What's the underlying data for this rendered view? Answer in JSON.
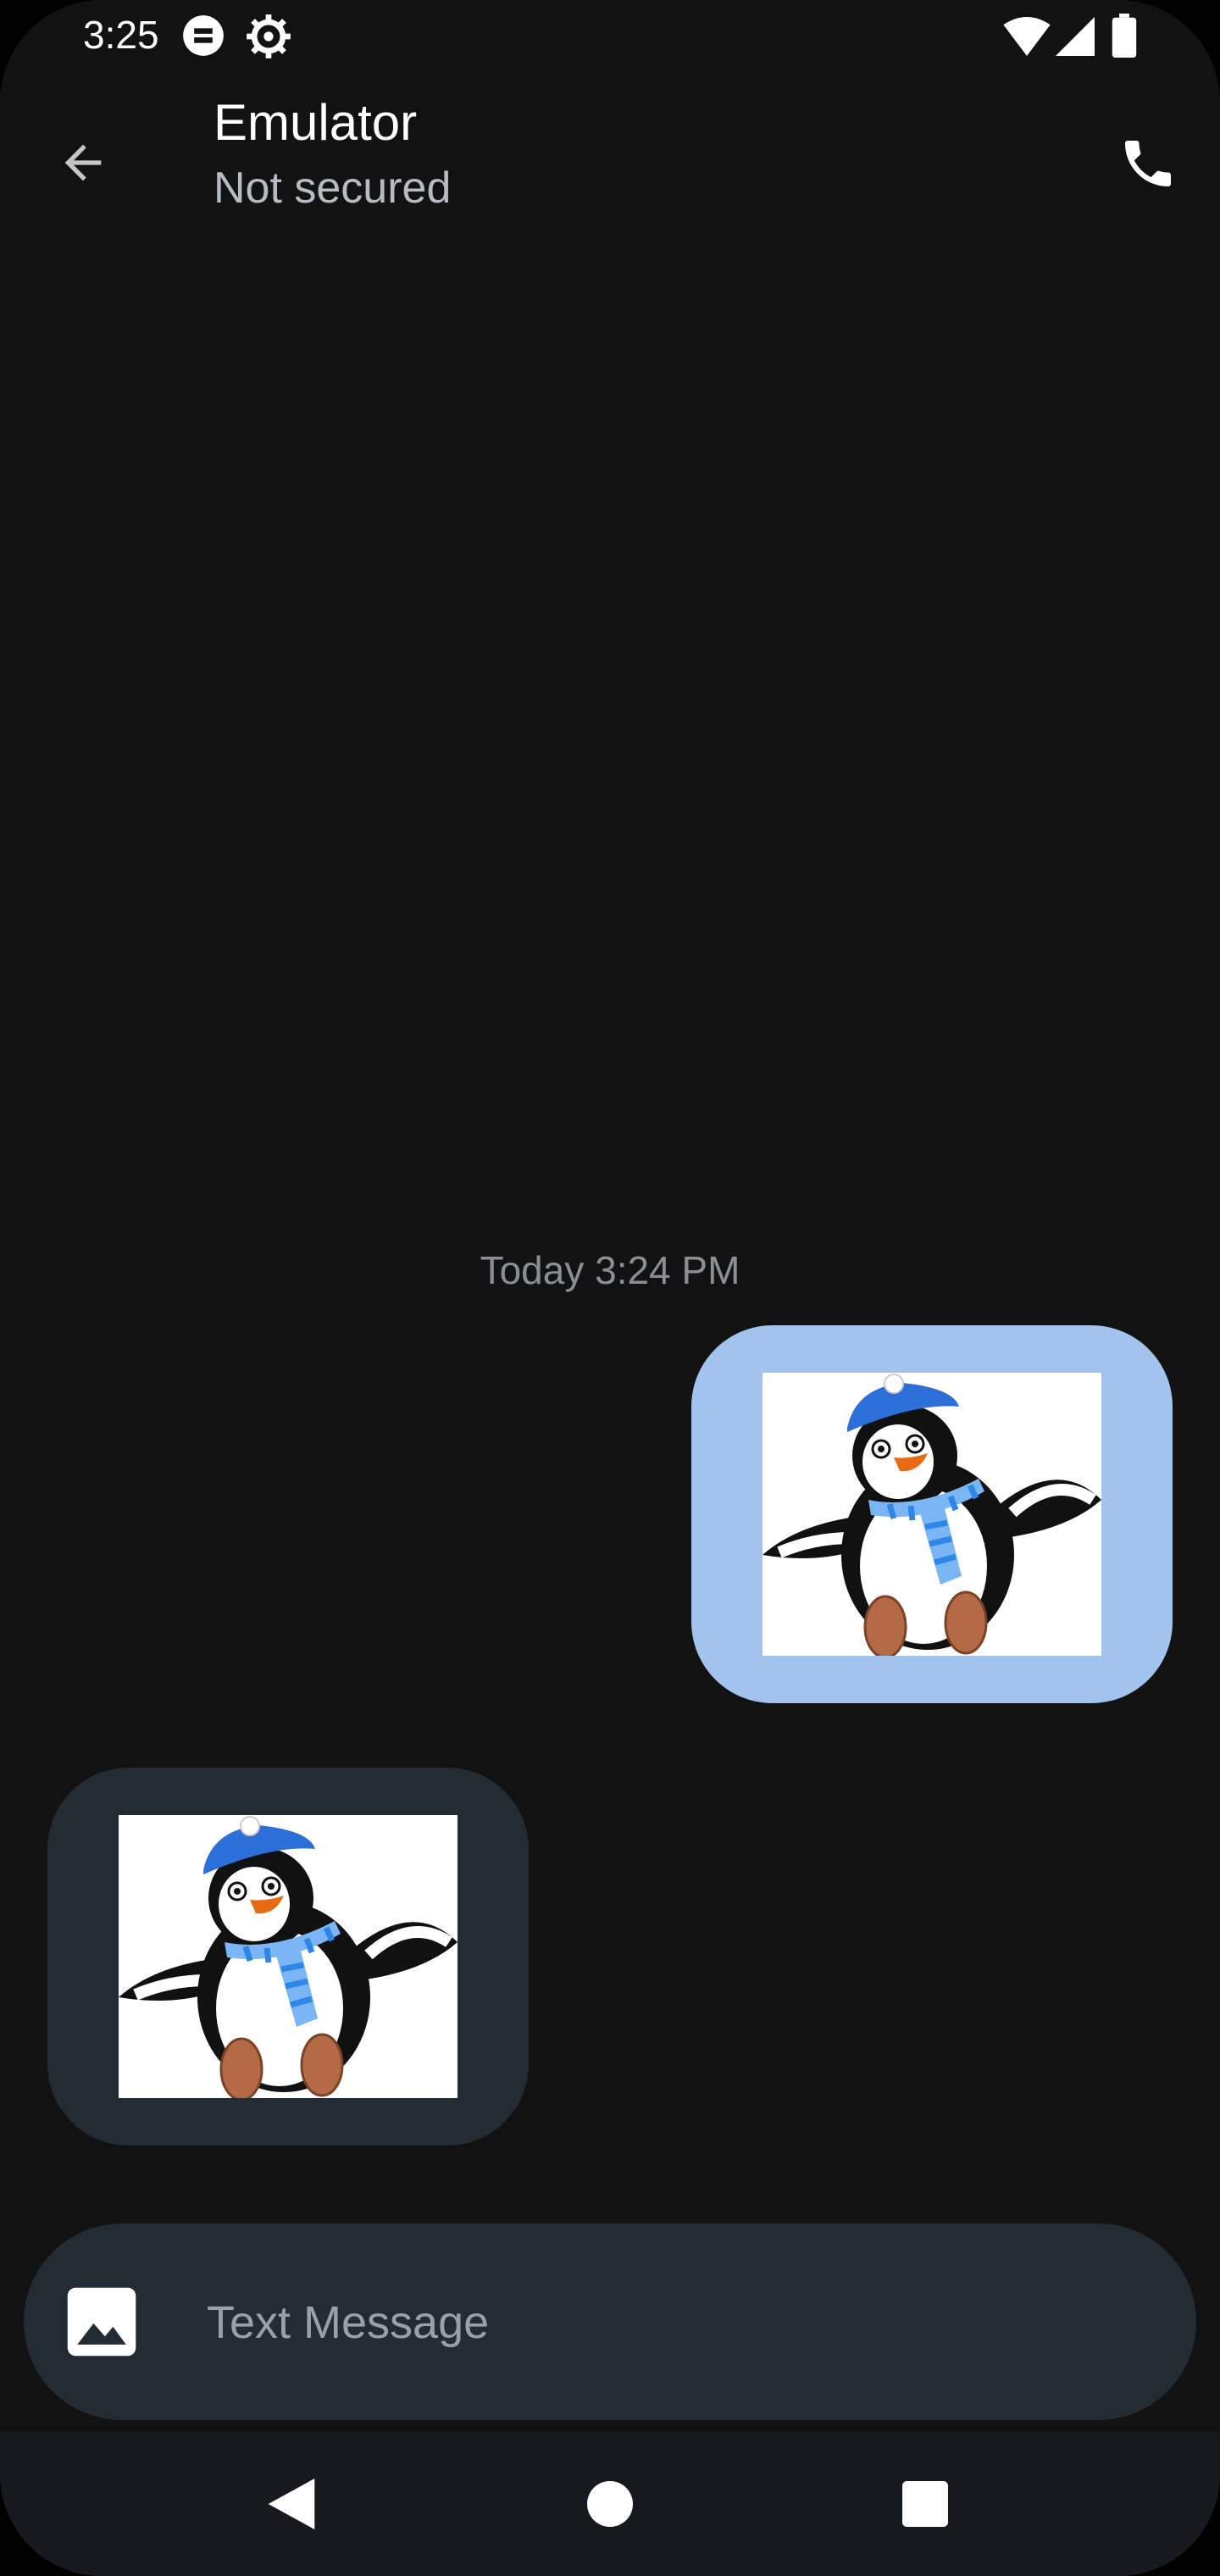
{
  "status_bar": {
    "time": "3:25",
    "left_icons": [
      "sim-card-icon",
      "settings-gear-icon"
    ],
    "right_icons": [
      "wifi-icon",
      "cell-signal-icon",
      "battery-icon"
    ]
  },
  "app_bar": {
    "back_icon": "arrow-back-icon",
    "title": "Emulator",
    "subtitle": "Not secured",
    "call_icon": "phone-icon"
  },
  "conversation": {
    "timestamp": "Today 3:24 PM",
    "messages": [
      {
        "direction": "outgoing",
        "type": "image",
        "content": "penguin-with-blue-hat-and-scarf",
        "bubble_color": "#a3c3ef"
      },
      {
        "direction": "incoming",
        "type": "image",
        "content": "penguin-with-blue-hat-and-scarf",
        "bubble_color": "#232b33"
      }
    ]
  },
  "compose": {
    "attach_icon": "image-gallery-icon",
    "placeholder": "Text Message",
    "value": ""
  },
  "nav_bar": {
    "buttons": [
      "back-triangle-icon",
      "home-circle-icon",
      "recents-square-icon"
    ]
  },
  "colors": {
    "background": "#121212",
    "outgoing_bubble": "#a3c3ef",
    "incoming_bubble": "#232b33",
    "compose_bar": "#232b33",
    "secondary_text": "#b7bcc2",
    "timestamp_text": "#8a8f94"
  }
}
